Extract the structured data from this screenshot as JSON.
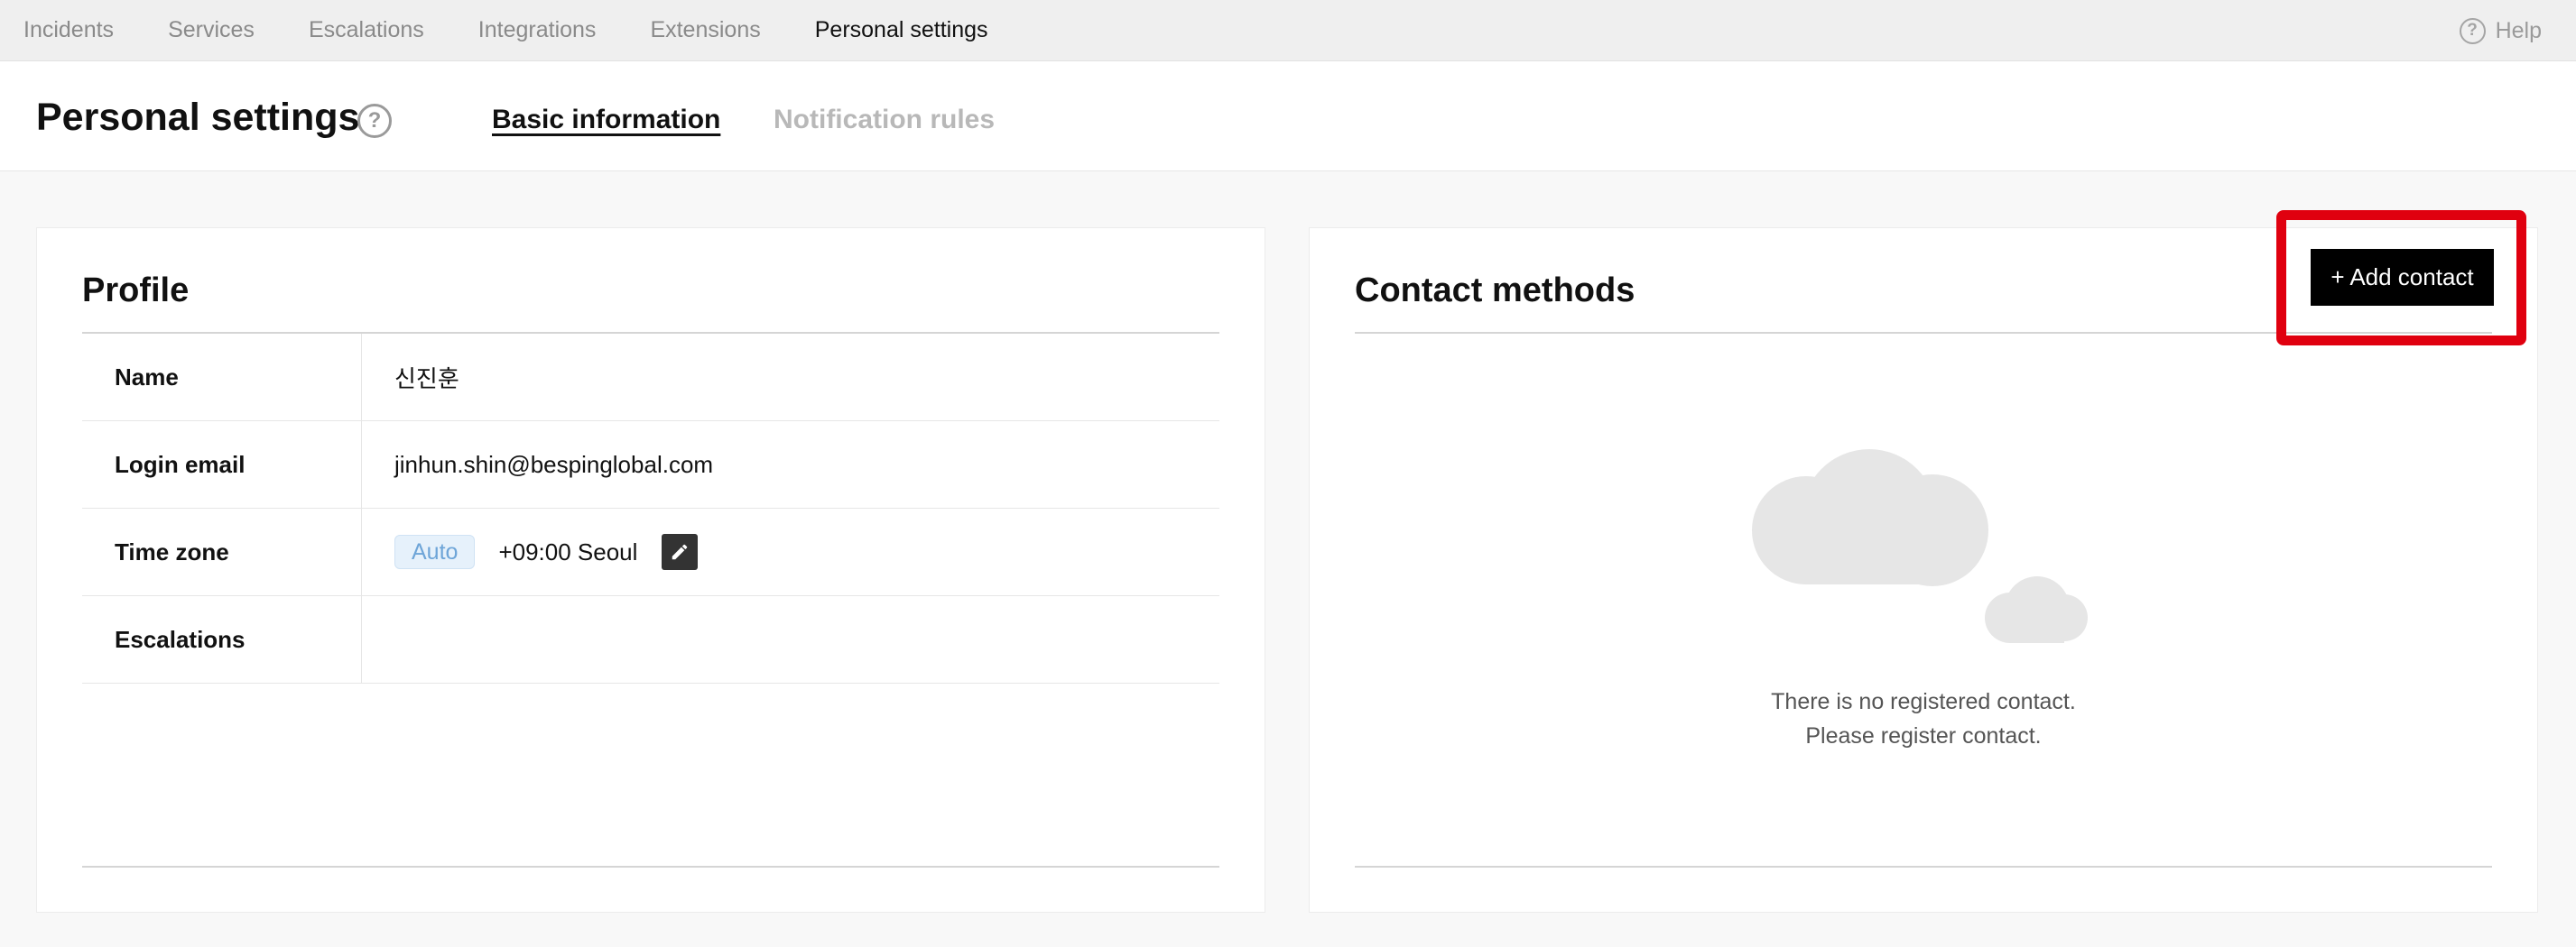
{
  "topnav": {
    "items": [
      {
        "label": "Incidents",
        "active": false
      },
      {
        "label": "Services",
        "active": false
      },
      {
        "label": "Escalations",
        "active": false
      },
      {
        "label": "Integrations",
        "active": false
      },
      {
        "label": "Extensions",
        "active": false
      },
      {
        "label": "Personal settings",
        "active": true
      }
    ],
    "help_label": "Help",
    "help_icon": "question-circle-icon"
  },
  "header": {
    "title": "Personal settings",
    "title_help_icon": "question-circle-icon",
    "tabs": [
      {
        "label": "Basic information",
        "active": true
      },
      {
        "label": "Notification rules",
        "active": false
      }
    ]
  },
  "profile": {
    "title": "Profile",
    "rows": [
      {
        "key": "Name",
        "value": "신진훈"
      },
      {
        "key": "Login email",
        "value": "jinhun.shin@bespinglobal.com"
      },
      {
        "key": "Time zone",
        "badge": "Auto",
        "value": "+09:00 Seoul",
        "edit_icon": "pencil-icon"
      },
      {
        "key": "Escalations",
        "value": ""
      }
    ]
  },
  "contacts": {
    "title": "Contact methods",
    "add_button": "+ Add contact",
    "empty_icon": "cloud-icon",
    "empty_line1": "There is no registered contact.",
    "empty_line2": "Please register contact."
  },
  "colors": {
    "highlight": "#e0000f",
    "nav_bg": "#efefef",
    "auto_badge_text": "#6ea5d8",
    "button_bg": "#000000"
  }
}
